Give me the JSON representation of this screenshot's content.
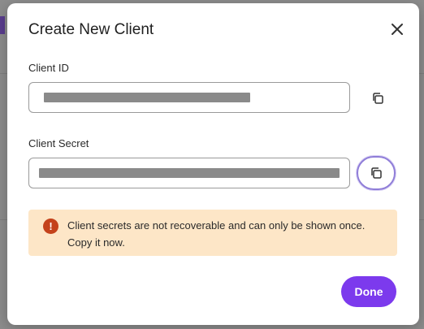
{
  "dialog": {
    "title": "Create New Client",
    "close_icon": "close-icon"
  },
  "fields": {
    "client_id": {
      "label": "Client ID",
      "value_masked": true,
      "copy_icon": "copy-icon"
    },
    "client_secret": {
      "label": "Client Secret",
      "value_masked": true,
      "copy_icon": "copy-icon"
    }
  },
  "warning": {
    "icon": "exclamation-icon",
    "text": "Client secrets are not recoverable and can only be shown once. Copy it now."
  },
  "actions": {
    "done_label": "Done"
  },
  "colors": {
    "accent": "#7c3aed",
    "focus_ring": "#8f7dd8",
    "warning_bg": "#fde6c7",
    "warning_icon": "#c4421b"
  }
}
